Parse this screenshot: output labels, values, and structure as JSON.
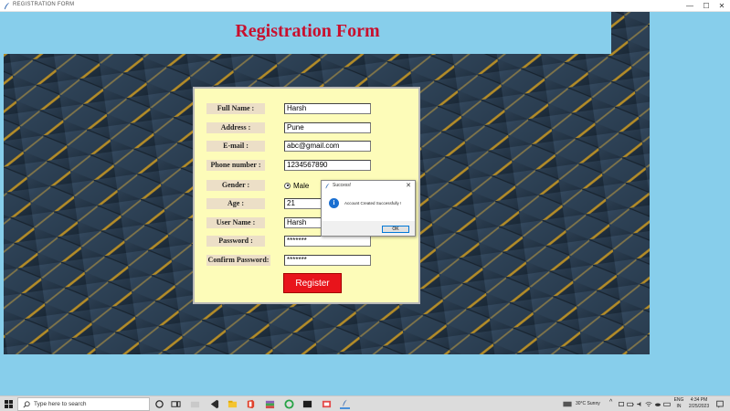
{
  "window": {
    "title": "REGISTRATION FORM",
    "minimize": "—",
    "maximize": "☐",
    "close": "✕"
  },
  "banner": {
    "heading": "Registration Form"
  },
  "form": {
    "fields": [
      {
        "label": "Full Name :",
        "value": "Harsh"
      },
      {
        "label": "Address :",
        "value": "Pune"
      },
      {
        "label": "E-mail :",
        "value": "abc@gmail.com"
      },
      {
        "label": "Phone number :",
        "value": "1234567890"
      },
      {
        "label": "Gender :",
        "value": "Male"
      },
      {
        "label": "Age :",
        "value": "21"
      },
      {
        "label": "User Name :",
        "value": "Harsh"
      },
      {
        "label": "Password :",
        "value": "*******"
      },
      {
        "label": "Confirm Password:",
        "value": "*******"
      }
    ],
    "register_label": "Register"
  },
  "dialog": {
    "title": "Success!",
    "close": "✕",
    "icon": "info-icon",
    "icon_glyph": "i",
    "message": "Account Created Successfully !",
    "ok_label": "OK"
  },
  "taskbar": {
    "search_placeholder": "Type here to search",
    "weather": "30°C  Sunny",
    "language_1": "ENG",
    "language_2": "IN",
    "time": "4:34 PM",
    "date": "2/25/2023"
  },
  "colors": {
    "background": "#87ceeb",
    "heading": "#c8102e",
    "panel": "#fdfcb9",
    "label_bg": "#ecdfc7",
    "register": "#e8141b"
  }
}
